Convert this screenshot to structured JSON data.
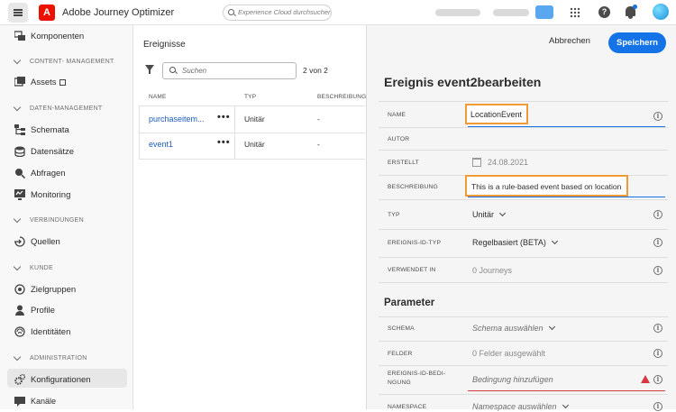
{
  "app": {
    "name": "Adobe Journey Optimizer",
    "search_placeholder": "Experience Cloud durchsuchen ..."
  },
  "sidebar": {
    "items": [
      {
        "type": "item",
        "label": "Komponenten",
        "icon": "components-icon"
      },
      {
        "type": "section",
        "label": "CONTENT- MANAGEMENT"
      },
      {
        "type": "item",
        "label": "Assets",
        "icon": "assets-icon",
        "external": true
      },
      {
        "type": "section",
        "label": "DATEN-MANAGEMENT"
      },
      {
        "type": "item",
        "label": "Schemata",
        "icon": "schema-icon"
      },
      {
        "type": "item",
        "label": "Datensätze",
        "icon": "datasets-icon"
      },
      {
        "type": "item",
        "label": "Abfragen",
        "icon": "queries-icon"
      },
      {
        "type": "item",
        "label": "Monitoring",
        "icon": "monitoring-icon"
      },
      {
        "type": "section",
        "label": "VERBINDUNGEN"
      },
      {
        "type": "item",
        "label": "Quellen",
        "icon": "sources-icon"
      },
      {
        "type": "section",
        "label": "KUNDE"
      },
      {
        "type": "item",
        "label": "Zielgruppen",
        "icon": "audiences-icon"
      },
      {
        "type": "item",
        "label": "Profile",
        "icon": "profile-icon"
      },
      {
        "type": "item",
        "label": "Identitäten",
        "icon": "identities-icon"
      },
      {
        "type": "section",
        "label": "ADMINISTRATION"
      },
      {
        "type": "item",
        "label": "Konfigurationen",
        "icon": "gear-icon",
        "active": true
      },
      {
        "type": "item",
        "label": "Kanäle",
        "icon": "channels-icon"
      }
    ]
  },
  "events_list": {
    "title": "Ereignisse",
    "search_placeholder": "Suchen",
    "count": "2 von 2",
    "columns": [
      "NAME",
      "TYP",
      "BESCHREIBUNG"
    ],
    "rows": [
      {
        "name": "purchaseitem...",
        "type": "Unitär",
        "description": "-"
      },
      {
        "name": "event1",
        "type": "Unitär",
        "description": "-"
      }
    ],
    "more": "•••"
  },
  "edit_panel": {
    "cancel_label": "Abbrechen",
    "save_label": "Speichern",
    "title": "Ereignis event2bearbeiten",
    "fields": {
      "name": {
        "label": "NAME",
        "value": "LocationEvent"
      },
      "author": {
        "label": "AUTOR",
        "value": ""
      },
      "created": {
        "label": "ERSTELLT",
        "value": "24.08.2021"
      },
      "description": {
        "label": "BESCHREIBUNG",
        "value": "This is a rule-based event based on location"
      },
      "type": {
        "label": "TYP",
        "value": "Unitär"
      },
      "id_type": {
        "label": "EREIGNIS-ID-TYP",
        "value": "Regelbasiert (BETA)"
      },
      "used_in": {
        "label": "VERWENDET IN",
        "value": "0 Journeys"
      }
    },
    "parameters": {
      "title": "Parameter",
      "schema": {
        "label": "SCHEMA",
        "value": "Schema auswählen"
      },
      "fields": {
        "label": "FELDER",
        "value": "0 Felder ausgewählt"
      },
      "id_condition": {
        "label_line1": "EREIGNIS-ID-BEDI-",
        "label_line2": "NGUNG",
        "value": "Bedingung hinzufügen"
      },
      "namespace": {
        "label": "NAMESPACE",
        "value": "Namespace auswählen"
      }
    }
  },
  "colors": {
    "accent": "#1473e6",
    "highlight": "#f19b36",
    "error": "#d7373f",
    "brand": "#eb1000"
  }
}
